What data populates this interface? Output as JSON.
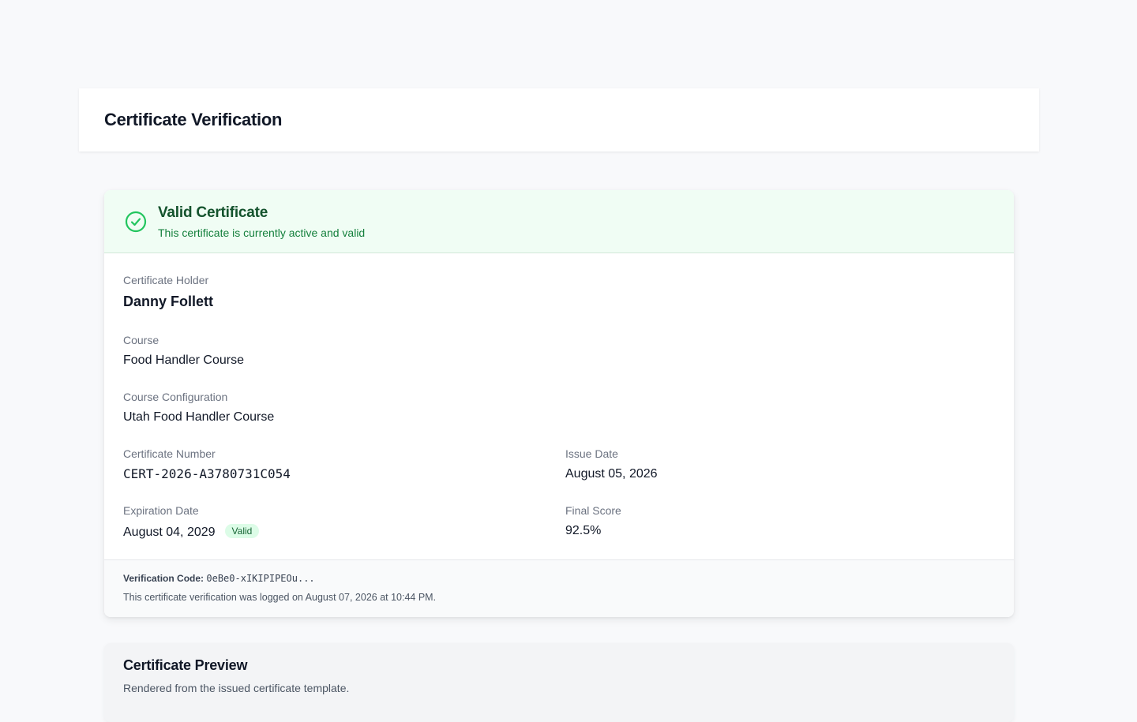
{
  "header": {
    "title": "Certificate Verification"
  },
  "status": {
    "title": "Valid Certificate",
    "subtitle": "This certificate is currently active and valid",
    "color": "#22c55e"
  },
  "certificate": {
    "holder_label": "Certificate Holder",
    "holder_value": "Danny Follett",
    "course_label": "Course",
    "course_value": "Food Handler Course",
    "config_label": "Course Configuration",
    "config_value": "Utah Food Handler Course",
    "number_label": "Certificate Number",
    "number_value": "CERT-2026-A3780731C054",
    "issue_label": "Issue Date",
    "issue_value": "August 05, 2026",
    "expiration_label": "Expiration Date",
    "expiration_value": "August 04, 2029",
    "expiration_badge": "Valid",
    "score_label": "Final Score",
    "score_value": "92.5%"
  },
  "footer": {
    "verification_label": "Verification Code:",
    "verification_code": "0eBe0-xIKIPIPEOu...",
    "logged_text": "This certificate verification was logged on August 07, 2026 at 10:44 PM."
  },
  "preview": {
    "title": "Certificate Preview",
    "subtitle": "Rendered from the issued certificate template."
  }
}
